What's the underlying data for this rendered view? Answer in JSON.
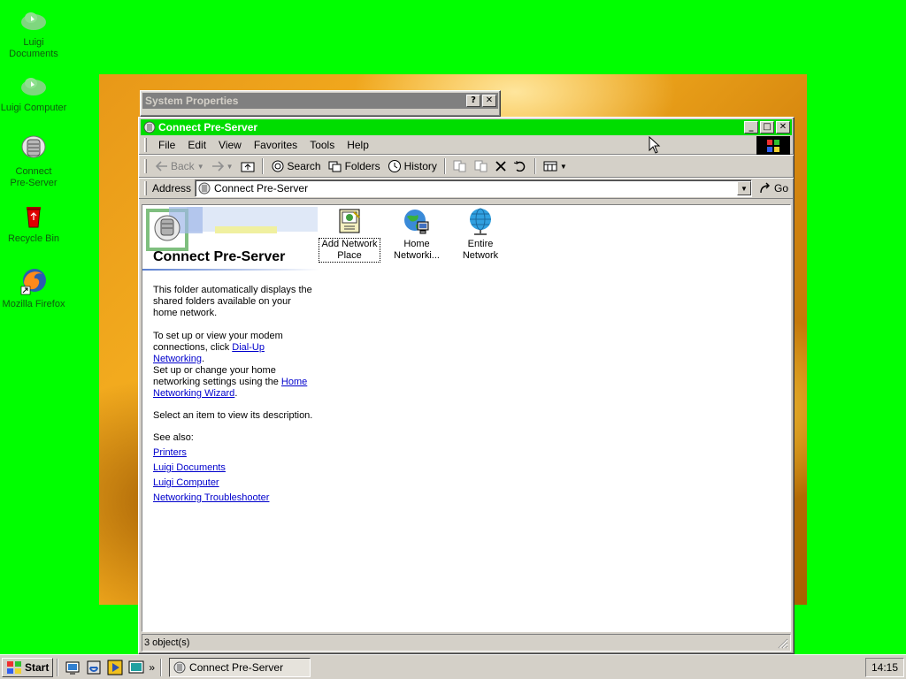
{
  "desktop": {
    "icons": [
      {
        "label": "Luigi Documents",
        "icon": "cloud-icon"
      },
      {
        "label": "Luigi Computer",
        "icon": "cloud-icon"
      },
      {
        "label": "Connect Pre-Server",
        "icon": "server-icon"
      },
      {
        "label": "Recycle Bin",
        "icon": "recycle-bin-icon"
      },
      {
        "label": "Mozilla Firefox",
        "icon": "firefox-icon"
      }
    ]
  },
  "system_properties": {
    "title": "System Properties",
    "help_glyph": "?",
    "close_glyph": "✕"
  },
  "explorer": {
    "title": "Connect Pre-Server",
    "controls": {
      "minimize": "_",
      "maximize": "□",
      "close": "✕"
    },
    "menu": [
      "File",
      "Edit",
      "View",
      "Favorites",
      "Tools",
      "Help"
    ],
    "toolbar": {
      "back": "Back",
      "search": "Search",
      "folders": "Folders",
      "history": "History"
    },
    "address": {
      "label": "Address",
      "value": "Connect Pre-Server",
      "go": "Go"
    },
    "webview": {
      "title": "Connect Pre-Server",
      "p1": "This folder automatically displays the shared folders available on your home network.",
      "p2_pre": "To set up or view your modem connections, click ",
      "p2_link": "Dial-Up Networking",
      "p2_post": ".",
      "p3_pre": "Set up or change your home networking settings using the ",
      "p3_link": "Home Networking Wizard",
      "p3_post": ".",
      "p4": "Select an item to view its description.",
      "see_also": "See also:",
      "links": [
        "Printers",
        "Luigi Documents",
        "Luigi Computer",
        "Networking Troubleshooter"
      ]
    },
    "items": [
      {
        "label": "Add Network Place",
        "icon": "add-network-place-icon",
        "selected": true
      },
      {
        "label": "Home Networki...",
        "icon": "home-network-icon",
        "selected": false
      },
      {
        "label": "Entire Network",
        "icon": "globe-icon",
        "selected": false
      }
    ],
    "status": "3 object(s)"
  },
  "taskbar": {
    "start": "Start",
    "quick_launch": [
      "show-desktop-icon",
      "launch-ie-icon",
      "media-player-icon",
      "desktop-icon"
    ],
    "overflow": "»",
    "task": "Connect Pre-Server",
    "clock": "14:15"
  },
  "colors": {
    "desktop": "#00ff00",
    "active_title": "#00dd00",
    "inactive_title": "#808080",
    "link": "#0000cc"
  }
}
